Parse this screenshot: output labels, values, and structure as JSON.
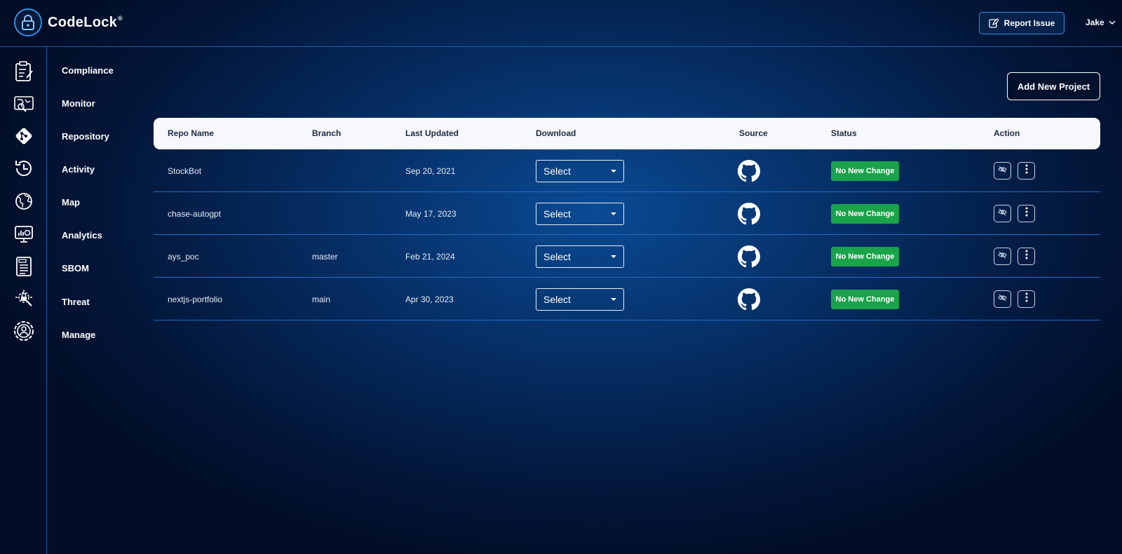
{
  "app": {
    "name": "CodeLock",
    "trademark": "®"
  },
  "header": {
    "report_label": "Report Issue",
    "user_name": "Jake"
  },
  "sidebar": {
    "items": [
      {
        "label": "Compliance",
        "icon": "clipboard-icon"
      },
      {
        "label": "Monitor",
        "icon": "monitor-map-icon"
      },
      {
        "label": "Repository",
        "icon": "git-icon"
      },
      {
        "label": "Activity",
        "icon": "history-icon"
      },
      {
        "label": "Map",
        "icon": "globe-icon"
      },
      {
        "label": "Analytics",
        "icon": "analytics-icon"
      },
      {
        "label": "SBOM",
        "icon": "document-icon"
      },
      {
        "label": "Threat",
        "icon": "threat-icon"
      },
      {
        "label": "Manage",
        "icon": "gear-user-icon"
      }
    ]
  },
  "main": {
    "add_project_label": "Add New Project",
    "table": {
      "headers": [
        "Repo Name",
        "Branch",
        "Last Updated",
        "Download",
        "Source",
        "Status",
        "Action"
      ],
      "rows": [
        {
          "repo": "StockBot",
          "branch": "",
          "updated": "Sep 20, 2021",
          "download": "Select",
          "source": "github-icon",
          "status": "No New Change"
        },
        {
          "repo": "chase-autogpt",
          "branch": "",
          "updated": "May 17, 2023",
          "download": "Select",
          "source": "github-icon",
          "status": "No New Change"
        },
        {
          "repo": "ays_poc",
          "branch": "master",
          "updated": "Feb 21, 2024",
          "download": "Select",
          "source": "github-icon",
          "status": "No New Change"
        },
        {
          "repo": "nextjs-portfolio",
          "branch": "main",
          "updated": "Apr 30, 2023",
          "download": "Select",
          "source": "github-icon",
          "status": "No New Change"
        }
      ]
    }
  },
  "colors": {
    "accent": "#2e8fe8",
    "status_green": "#1aa34a",
    "background": "#062f66"
  }
}
